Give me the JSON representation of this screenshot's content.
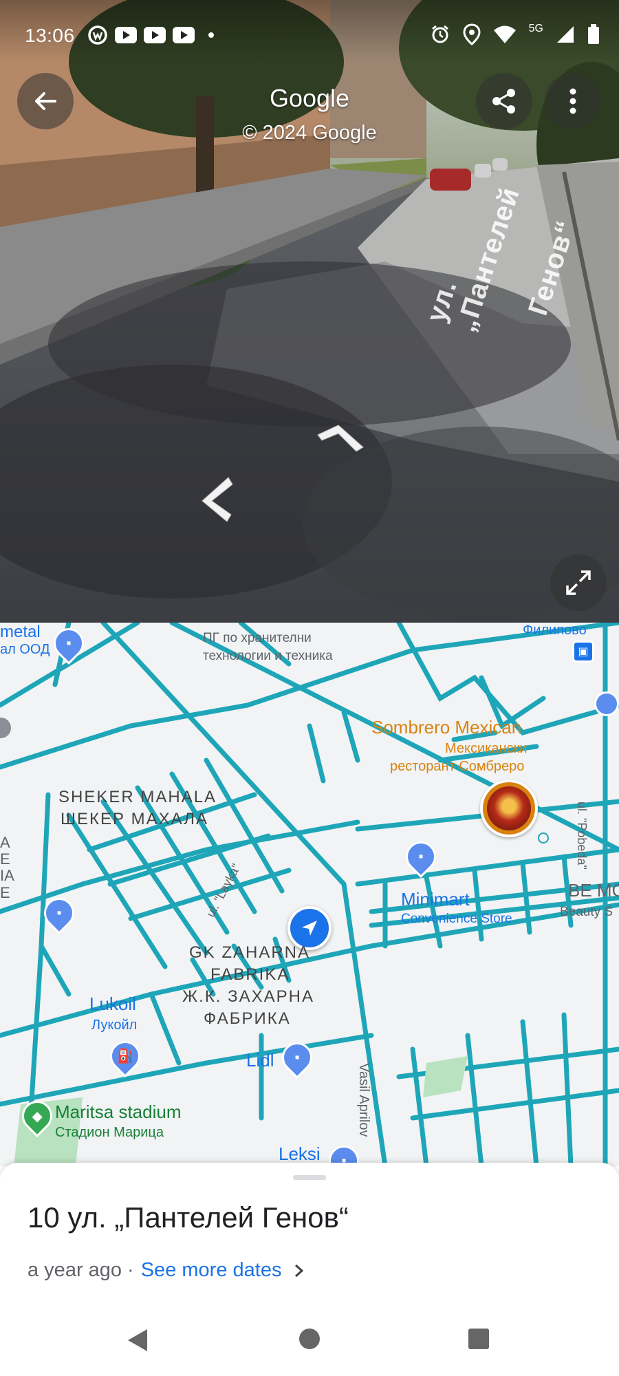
{
  "status_bar": {
    "time": "13:06",
    "network": "5G",
    "icons": [
      "app-w-icon",
      "youtube-icon",
      "youtube-icon",
      "youtube-icon",
      "notification-dot-icon",
      "alarm-icon",
      "location-icon",
      "wifi-icon",
      "signal-icon",
      "battery-icon"
    ]
  },
  "street_view": {
    "title": "Google",
    "copyright": "© 2024 Google",
    "street_sign_line1": "ул. „Пантелей",
    "street_sign_line2": "Генов“",
    "buttons": [
      "back-arrow-icon",
      "share-icon",
      "more-vert-icon",
      "expand-icon"
    ]
  },
  "map": {
    "labels": {
      "metal": "metal",
      "metal_sub": "ал ООД",
      "pg_school": "ПГ по хранителни",
      "pg_school_2": "технологии и техника",
      "filipovo": "Филипово",
      "sombrero": "Sombrero Mexican",
      "sombrero_bg1": "Мексикански",
      "sombrero_bg2": "ресторант Сомбреро",
      "sheker_en": "SHEKER MAHALA",
      "sheker_bg": "ШЕКЕР МАХАЛА",
      "pobeda": "ul. \"Pobeda\"",
      "layka": "ul. \"Layka\"",
      "minimart": "Minimart",
      "minimart_sub": "Convenience Store",
      "be_mo": "BE MO",
      "beauty": "Beauty S",
      "zaharna_en1": "GK ZAHARNA",
      "zaharna_en2": "FABRIKA",
      "zaharna_bg1": "Ж.К. ЗАХАРНА",
      "zaharna_bg2": "ФАБРИКА",
      "lukoil_en": "Lukoil",
      "lukoil_bg": "Лукойл",
      "lidl": "Lidl",
      "vasil": "Vasil Aprilov",
      "maritsa_en": "Maritsa stadium",
      "maritsa_bg": "Стадион Марица",
      "leksi": "Leksi",
      "left_edge": [
        "A",
        "E",
        "IA",
        "E"
      ]
    }
  },
  "sheet": {
    "address": "10 ул. „Пантелей Генов“",
    "age": "a year ago",
    "separator": "·",
    "see_more": "See more dates"
  },
  "colors": {
    "road": "#1ea6b8",
    "map_bg": "#f1f3f4",
    "link": "#1a73e8",
    "poi_orange": "#d9820f",
    "poi_blue": "#5b8def"
  }
}
